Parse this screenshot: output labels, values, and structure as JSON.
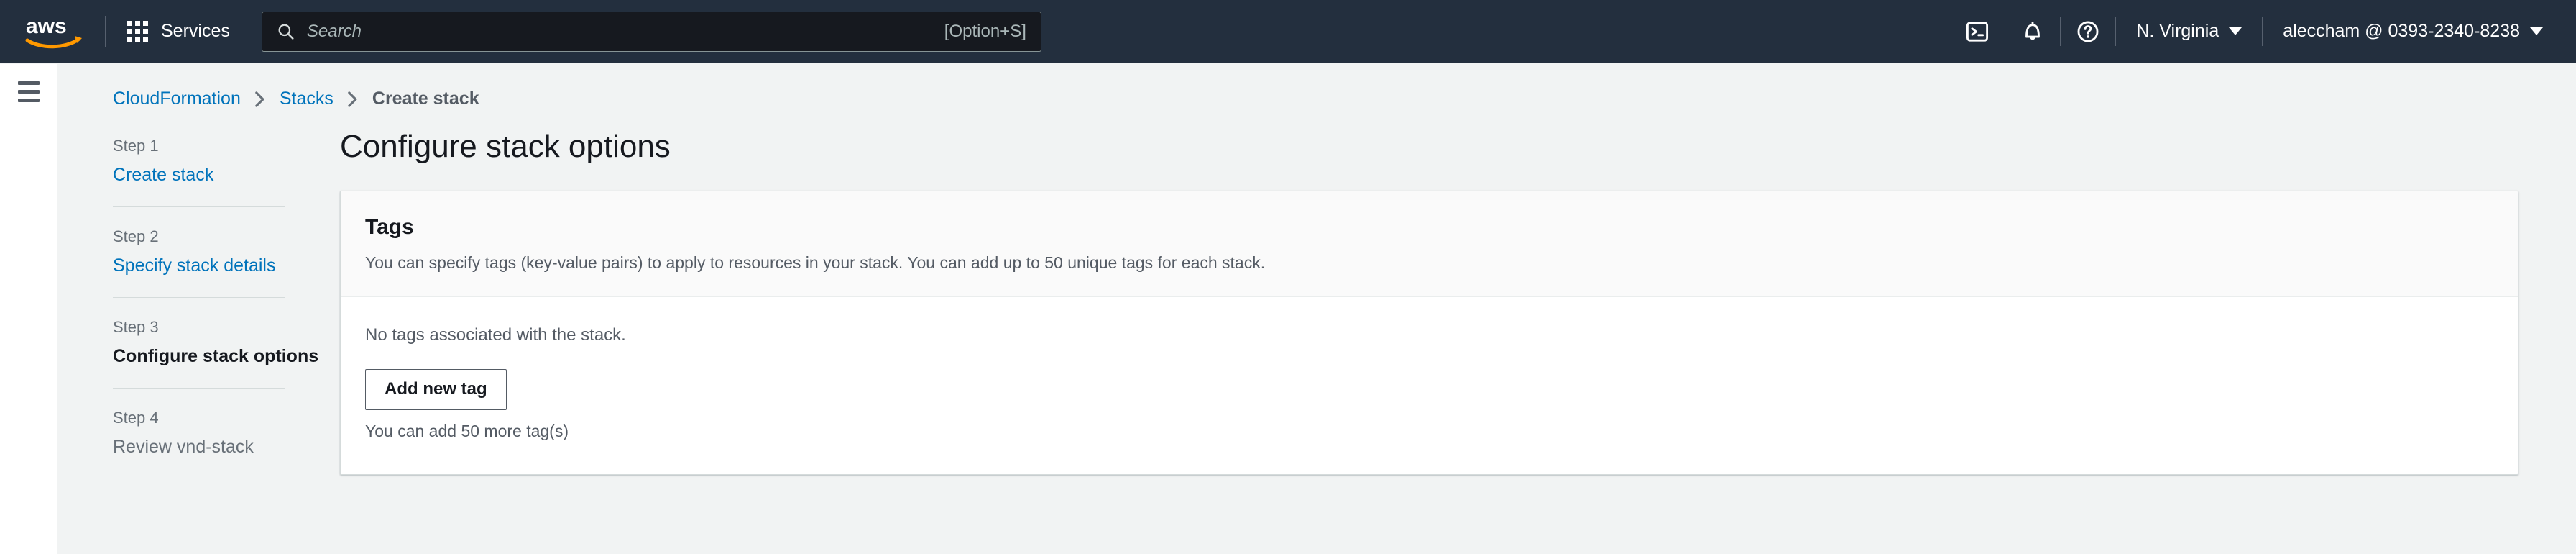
{
  "topnav": {
    "logo_alt": "aws",
    "services_label": "Services",
    "search": {
      "placeholder": "Search",
      "value": "",
      "shortcut": "[Option+S]"
    },
    "icons": [
      {
        "name": "cloudshell-icon",
        "title": "CloudShell"
      },
      {
        "name": "notifications-bell-icon",
        "title": "Notifications"
      },
      {
        "name": "help-question-icon",
        "title": "Help"
      }
    ],
    "region_label": "N. Virginia",
    "account_label": "aleccham @ 0393-2340-8238"
  },
  "breadcrumb": {
    "items": [
      {
        "label": "CloudFormation",
        "current": false
      },
      {
        "label": "Stacks",
        "current": false
      },
      {
        "label": "Create stack",
        "current": true
      }
    ],
    "separator": "›"
  },
  "wizard": {
    "steps": [
      {
        "label": "Step 1",
        "title": "Create stack",
        "state": "link"
      },
      {
        "label": "Step 2",
        "title": "Specify stack details",
        "state": "link"
      },
      {
        "label": "Step 3",
        "title": "Configure stack options",
        "state": "active"
      },
      {
        "label": "Step 4",
        "title": "Review vnd-stack",
        "state": "pending"
      }
    ]
  },
  "page": {
    "title": "Configure stack options"
  },
  "tags_card": {
    "title": "Tags",
    "description": "You can specify tags (key-value pairs) to apply to resources in your stack. You can add up to 50 unique tags for each stack.",
    "empty_message": "No tags associated with the stack.",
    "add_button_label": "Add new tag",
    "remaining_hint": "You can add 50 more tag(s)"
  },
  "colors": {
    "nav_background": "#232f3e",
    "page_background": "#f1f3f3",
    "link": "#0073bb",
    "aws_orange": "#ff9900",
    "card_background": "#ffffff",
    "card_header_background": "#fafafa",
    "border": "#d5dbdb",
    "muted_text": "#545b64"
  }
}
